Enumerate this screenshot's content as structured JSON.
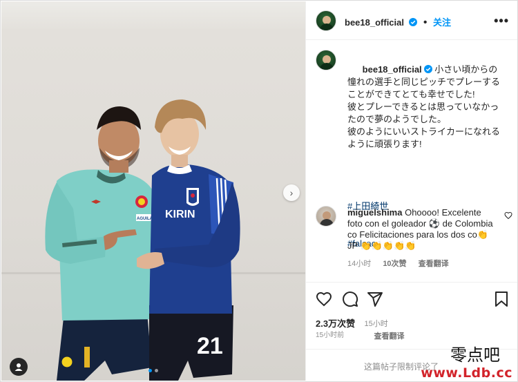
{
  "post": {
    "author": "bee18_official",
    "follow_label": "关注",
    "more_label": "•••"
  },
  "caption": {
    "author": "bee18_official",
    "text": "小さい頃からの憧れの選手と同じピッチでプレーすることができてとても幸せでした!\n彼とプレーできるとは思っていなかったので夢のようでした。\n彼のようにいいストライカーになれるように頑張ります!",
    "hashtags": [
      "#上田綺世",
      "#falcao"
    ],
    "time": "15小时",
    "translate": "查看翻译"
  },
  "comment": {
    "author": "miguelshima",
    "text": "Ohoooo! Excelente foto con el goleador ⚽ de Colombia co Felicitaciones para los dos co👏JP 👏👏👏👏👏",
    "time": "14小时",
    "replies": "10次赞",
    "translate": "查看翻译"
  },
  "stats": {
    "likes": "2.3万次赞",
    "posted": "15小时前"
  },
  "footer": {
    "comments_limited": "这篇帖子限制评论了"
  },
  "watermark": {
    "cn": "零点吧",
    "url": "www.Ldb.cc"
  },
  "jersey": {
    "sponsor": "KIRIN",
    "number": "21",
    "badge": "AGUILA"
  },
  "colors": {
    "accent": "#0095f6",
    "hashtag": "#00376b",
    "secondary_text": "#8e8e8e",
    "watermark_red": "#d2232a"
  },
  "icons": [
    "verified-badge-icon",
    "more-icon",
    "heart-icon",
    "comment-icon",
    "share-icon",
    "bookmark-icon",
    "tag-person-icon",
    "chevron-right-icon"
  ]
}
